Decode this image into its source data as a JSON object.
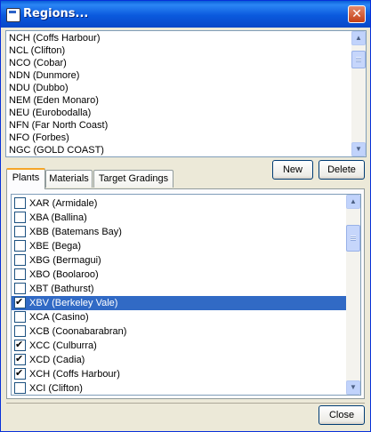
{
  "window": {
    "title": "Regions..."
  },
  "regions": [
    "NCH (Coffs Harbour)",
    "NCL (Clifton)",
    "NCO (Cobar)",
    "NDN (Dunmore)",
    "NDU (Dubbo)",
    "NEM (Eden Monaro)",
    "NEU (Eurobodalla)",
    "NFN (Far North Coast)",
    "NFO (Forbes)",
    "NGC (GOLD COAST)"
  ],
  "buttons": {
    "new": "New",
    "delete": "Delete",
    "close": "Close"
  },
  "tabs": [
    "Plants",
    "Materials",
    "Target Gradings"
  ],
  "plants": [
    {
      "label": "XAR (Armidale)",
      "checked": false,
      "selected": false
    },
    {
      "label": "XBA (Ballina)",
      "checked": false,
      "selected": false
    },
    {
      "label": "XBB (Batemans Bay)",
      "checked": false,
      "selected": false
    },
    {
      "label": "XBE (Bega)",
      "checked": false,
      "selected": false
    },
    {
      "label": "XBG (Bermagui)",
      "checked": false,
      "selected": false
    },
    {
      "label": "XBO (Boolaroo)",
      "checked": false,
      "selected": false
    },
    {
      "label": "XBT (Bathurst)",
      "checked": false,
      "selected": false
    },
    {
      "label": "XBV (Berkeley Vale)",
      "checked": true,
      "selected": true
    },
    {
      "label": "XCA (Casino)",
      "checked": false,
      "selected": false
    },
    {
      "label": "XCB (Coonabarabran)",
      "checked": false,
      "selected": false
    },
    {
      "label": "XCC (Culburra)",
      "checked": true,
      "selected": false
    },
    {
      "label": "XCD (Cadia)",
      "checked": true,
      "selected": false
    },
    {
      "label": "XCH (Coffs Harbour)",
      "checked": true,
      "selected": false
    },
    {
      "label": "XCI (Clifton)",
      "checked": false,
      "selected": false
    }
  ]
}
